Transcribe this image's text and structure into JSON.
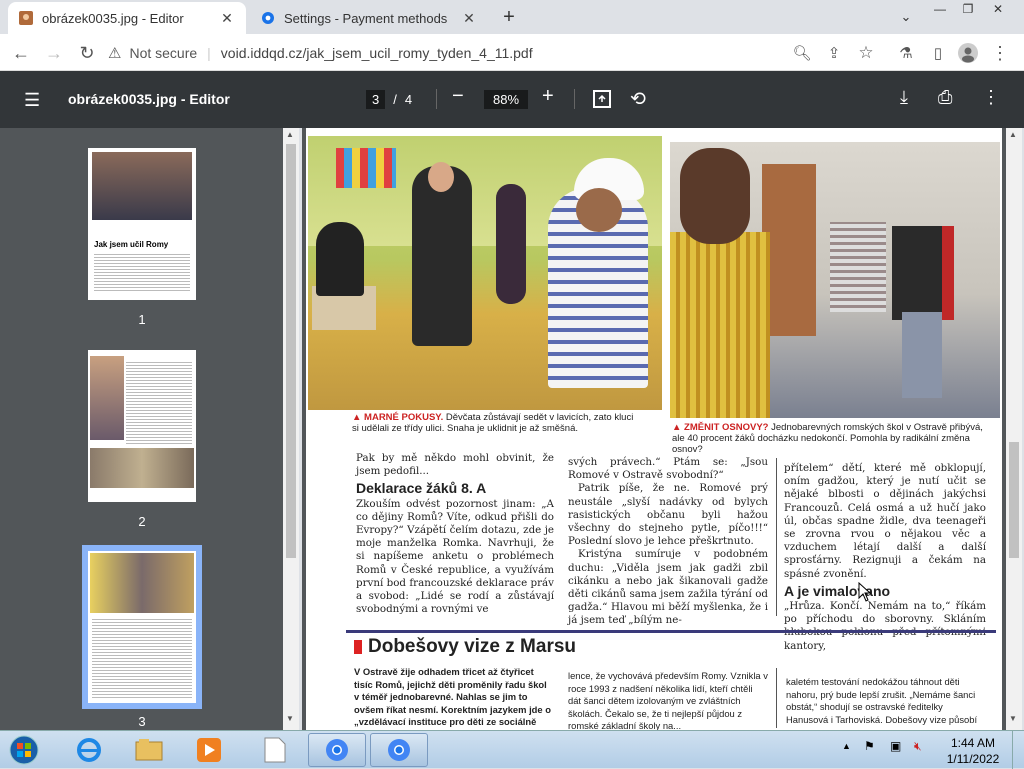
{
  "browser": {
    "tabs": [
      {
        "title": "obrázek0035.jpg - Editor",
        "active": true
      },
      {
        "title": "Settings - Payment methods",
        "active": false
      }
    ],
    "security_label": "Not secure",
    "url": "void.iddqd.cz/jak_jsem_ucil_romy_tyden_4_11.pdf"
  },
  "pdf_toolbar": {
    "title": "obrázek0035.jpg - Editor",
    "current_page": "3",
    "separator": "/",
    "total_pages": "4",
    "zoom": "88%"
  },
  "sidebar": {
    "thumbnails": [
      {
        "label": "1",
        "headline": "Jak jsem učil Romy"
      },
      {
        "label": "2"
      },
      {
        "label": "3",
        "selected": true
      }
    ]
  },
  "article": {
    "caption_left_head": "▲ MARNÉ POKUSY.",
    "caption_left": "Děvčata zůstávají sedět v lavicích, zato kluci si udělali ze třídy ulici. Snaha je uklidnit je až směšná.",
    "caption_right_head": "▲ ZMĚNIT OSNOVY?",
    "caption_right": "Jednobarevných romských škol v Ostravě přibývá, ale 40 procent žáků docházku nedokončí. Pomohla by radikální změna osnov?",
    "col1_intro": "Pak by mě někdo mohl obvinit, že jsem pedofil...",
    "col1_heading": "Deklarace žáků 8. A",
    "col1_text": "Zkouším odvést pozornost jinam: „A co dějiny Romů? Víte, odkud přišli do Evropy?“ Vzápětí čelím dotazu, zde je moje manželka Romka. Navrhuji, že si napíšeme anketu o problémech Romů v České republice, a využívám první bod francouzské deklarace práv a svobod: „Lidé se rodí a zůstávají svobodnými a rovnými ve",
    "col2_text1": "svých právech.“ Ptám se: „Jsou Romové v Ostravě svobodní?“",
    "col2_text2": "Patrik píše, že ne. Romové prý neustále „slyší nadávky od bylych rasistických občanu byli hažou všechny do stejneho pytle, píčo!!!“ Poslední slovo je lehce přeškrtnuto.",
    "col2_text3": "Kristýna sumíruje v podobném duchu: „Viděla jsem jak gadži zbil cikánku a nebo jak šikanovali gadže děti cikánů sama jsem zažila týrání od gadža.“ Hlavou mi běží myšlenka, že i já jsem teď „bílým ne-",
    "col3_text": "přítelem“ dětí, které mě obklopují, oním gadžou, který je nutí učit se nějaké blbosti o dějinách jakýchsi Francouzů. Celá osmá a už hučí jako úl, občas spadne židle, dva teenageři se zrovna rvou o nějakou věc a vzduchem létají další a další sprosťárny. Rezignuji a čekám na spásné zvonění.",
    "col3_heading": "A je vimalovano",
    "col3_text2": "„Hrůza. Končí. Nemám na to,“ říkám po příchodu do sborovny. Skláním hlubokou poklonu před přítomnými kantory,",
    "vize_title": "Dobešovy vize z Marsu",
    "vize_col1": "V Ostravě žije odhadem třicet až čtyřicet tisíc Romů, jejichž děti proměnily řadu škol v téměř jednobarevné. Nahlas se jim to ovšem říkat nesmí. Korektním jazykem jde o „vzdělávací instituce pro děti ze sociálně vyloučených lokalit“",
    "vize_col2": "lence, že vychovává především Romy. Vznikla v roce 1993 z nadšení několika lidí, kteří chtěli dát šanci dětem izolovaným ve zvláštních školách. Čekalo se, že ti nejlepší půjdou z romské základní školy na...",
    "vize_col3": "kaletém testování nedokážou táhnout děti nahoru, prý bude lepší zrušit. „Nemáme šanci obstát,“ shodují se ostravské ředitelky Hanusová i Tarhoviská. Dobešovy vize působí"
  },
  "taskbar": {
    "time": "1:44 AM",
    "date": "1/11/2022"
  }
}
